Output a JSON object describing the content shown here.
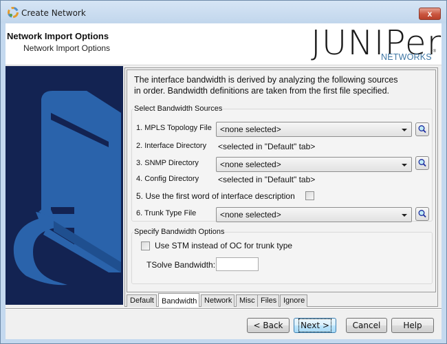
{
  "window": {
    "title": "Create Network",
    "close_label": "x"
  },
  "header": {
    "title": "Network Import Options",
    "subtitle": "Network Import Options",
    "logo_main": "JUNIPer",
    "logo_sub": "NETWORKS",
    "logo_reg": "®"
  },
  "main": {
    "intro_line1": "The interface bandwidth is derived by analyzing the following sources",
    "intro_line2": "in order.  Bandwidth definitions are taken from the first file specified.",
    "sources": {
      "legend": "Select Bandwidth Sources",
      "rows": [
        {
          "label": "1. MPLS Topology File",
          "type": "combo",
          "value": "<none selected>"
        },
        {
          "label": "2. Interface Directory",
          "type": "text",
          "value": "<selected in \"Default\" tab>"
        },
        {
          "label": "3. SNMP Directory",
          "type": "combo",
          "value": "<none selected>"
        },
        {
          "label": "4. Config Directory",
          "type": "text",
          "value": "<selected in \"Default\" tab>"
        },
        {
          "label": "5. Use the first word of interface description",
          "type": "checkbox",
          "checked": false
        },
        {
          "label": "6. Trunk Type File",
          "type": "combo",
          "value": "<none selected>"
        }
      ]
    },
    "options": {
      "legend": "Specify Bandwidth Options",
      "stm_label": "Use STM instead of OC for trunk type",
      "stm_checked": false,
      "tsolve_label": "TSolve Bandwidth:",
      "tsolve_value": ""
    },
    "tabs": [
      {
        "label": "Default",
        "active": false
      },
      {
        "label": "Bandwidth",
        "active": true
      },
      {
        "label": "Network",
        "active": false
      },
      {
        "label": "Misc",
        "active": false
      },
      {
        "label": "Files",
        "active": false
      },
      {
        "label": "Ignore",
        "active": false
      }
    ]
  },
  "footer": {
    "back": "< Back",
    "next": "Next >",
    "cancel": "Cancel",
    "help": "Help"
  },
  "colors": {
    "side_panel_bg": "#132352",
    "side_panel_art": "#2a63ab",
    "logo_sub": "#3e76a4"
  }
}
